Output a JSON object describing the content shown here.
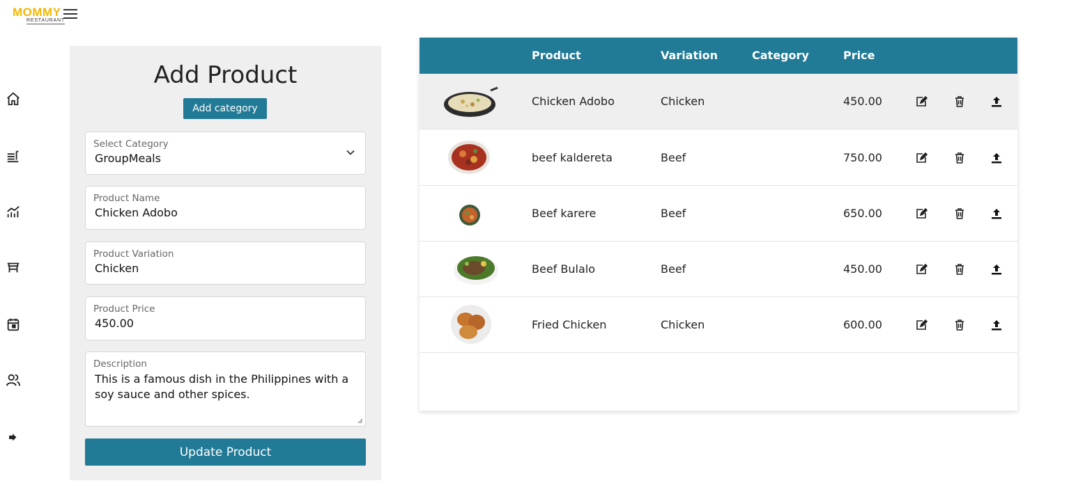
{
  "brand": {
    "name": "MOMMY",
    "subtitle": "RESTAURANT"
  },
  "nav": [
    "home-icon",
    "menu-icon",
    "analytics-icon",
    "table-icon",
    "calendar-icon",
    "users-icon",
    "logout-icon"
  ],
  "form": {
    "title": "Add Product",
    "add_category_label": "Add category",
    "category": {
      "label": "Select Category",
      "value": "GroupMeals"
    },
    "name": {
      "label": "Product Name",
      "value": "Chicken Adobo"
    },
    "variation": {
      "label": "Product Variation",
      "value": "Chicken"
    },
    "price": {
      "label": "Product Price",
      "value": "450.00"
    },
    "description": {
      "label": "Description",
      "value": "This is a famous dish in the Philippines with a soy sauce and other spices."
    },
    "submit_label": "Update Product"
  },
  "table": {
    "headers": {
      "product": "Product",
      "variation": "Variation",
      "category": "Category",
      "price": "Price"
    },
    "rows": [
      {
        "product": "Chicken Adobo",
        "variation": "Chicken",
        "category": "",
        "price": "450.00"
      },
      {
        "product": "beef kaldereta",
        "variation": "Beef",
        "category": "",
        "price": "750.00"
      },
      {
        "product": "Beef karere",
        "variation": "Beef",
        "category": "",
        "price": "650.00"
      },
      {
        "product": "Beef Bulalo",
        "variation": "Beef",
        "category": "",
        "price": "450.00"
      },
      {
        "product": "Fried Chicken",
        "variation": "Chicken",
        "category": "",
        "price": "600.00"
      }
    ]
  },
  "colors": {
    "accent": "#217a96",
    "panel": "#efefef",
    "logo": "#f2b705"
  }
}
